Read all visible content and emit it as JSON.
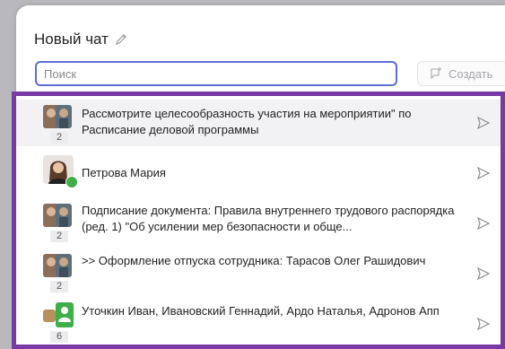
{
  "header": {
    "title": "Новый чат"
  },
  "search": {
    "placeholder": "Поиск"
  },
  "create_button": {
    "label": "Создать"
  },
  "chats": [
    {
      "text": "Рассмотрите целесообразность участия на мероприятии\" по Расписание деловой программы",
      "count": "2"
    },
    {
      "text": "Петрова Мария",
      "count": ""
    },
    {
      "text": "Подписание документа: Правила внутреннего трудового распорядка (ред. 1) \"Об усилении мер безопасности и обще...",
      "count": "2"
    },
    {
      "text": ">> Оформление отпуска сотрудника: Тарасов Олег Рашидович",
      "count": "2"
    },
    {
      "text": "Уточкин Иван, Ивановский Геннадий, Ардо Наталья, Адронов Апп",
      "count": "6"
    }
  ],
  "colors": {
    "accent": "#5c6dd6",
    "selection_border": "#7a3aa6",
    "online": "#3fae4a"
  }
}
